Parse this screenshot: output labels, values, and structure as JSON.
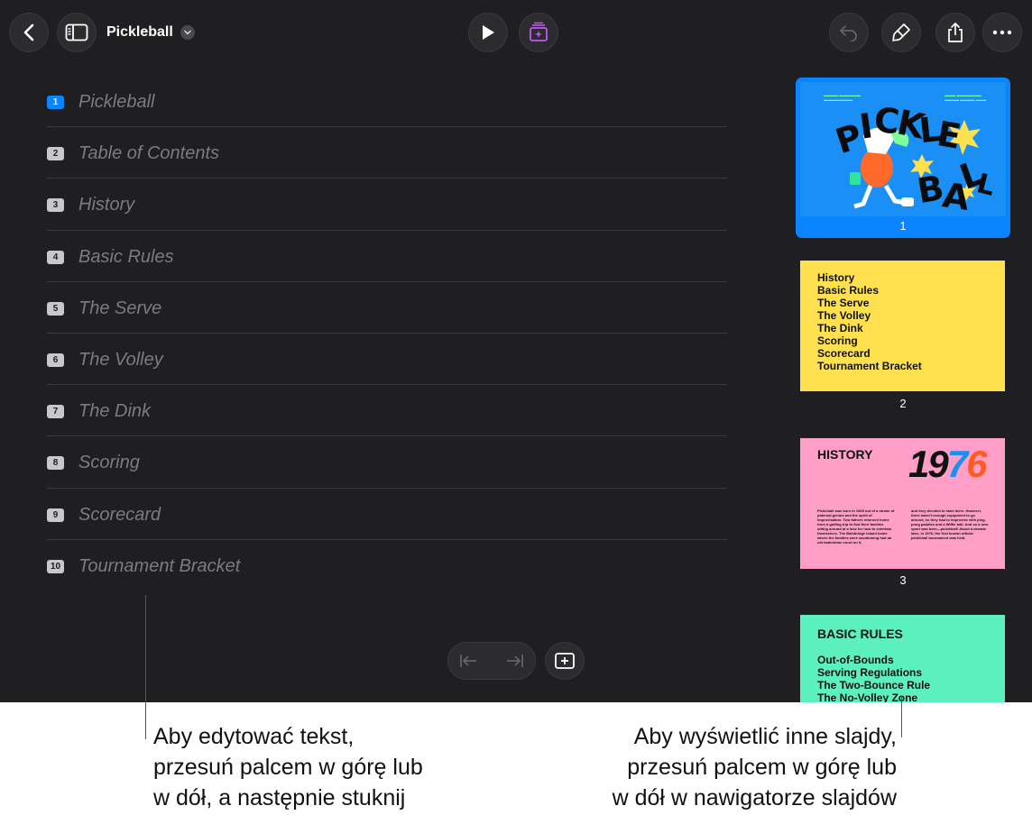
{
  "header": {
    "title": "Pickleball"
  },
  "outline": {
    "items": [
      {
        "num": "1",
        "title": "Pickleball"
      },
      {
        "num": "2",
        "title": "Table of Contents"
      },
      {
        "num": "3",
        "title": "History"
      },
      {
        "num": "4",
        "title": "Basic Rules"
      },
      {
        "num": "5",
        "title": "The Serve"
      },
      {
        "num": "6",
        "title": "The Volley"
      },
      {
        "num": "7",
        "title": "The Dink"
      },
      {
        "num": "8",
        "title": "Scoring"
      },
      {
        "num": "9",
        "title": "Scorecard"
      },
      {
        "num": "10",
        "title": "Tournament Bracket"
      }
    ]
  },
  "navigator": {
    "slide1": {
      "num": "1",
      "letters": "PICKLE BALL"
    },
    "slide2": {
      "num": "2",
      "items": [
        "History",
        "Basic Rules",
        "The Serve",
        "The Volley",
        "The Dink",
        "Scoring",
        "Scorecard",
        "Tournament Bracket"
      ]
    },
    "slide3": {
      "num": "3",
      "heading": "HISTORY",
      "year_a": "19",
      "year_b": "7",
      "year_c": "6",
      "col1": "Pickleball was born in 1965 out of a stroke of paternal genius and the spirit of improvisation. Two fathers returned home from a golfing trip to find their families sitting around at a loss for how to entertain themselves. The Bainbridge Island home where the families were vacationing had an old badminton court on it,",
      "col2": "and they decided to start there. However, there wasn't enough equipment to go around, so they had to improvise with ping-pong paddles and a Wiffle ball. And so a new sport was born—pickleball! About a decade later, in 1976, the first known official pickleball tournament was held."
    },
    "slide4": {
      "heading": "BASIC RULES",
      "items": [
        "Out-of-Bounds",
        "Serving Regulations",
        "The Two-Bounce Rule",
        "The No-Volley Zone"
      ]
    }
  },
  "callouts": {
    "left": [
      "Aby edytować tekst,",
      "przesuń palcem w górę lub",
      "w dół, a następnie stuknij"
    ],
    "right": [
      "Aby wyświetlić inne slajdy,",
      "przesuń palcem w górę lub",
      "w dół w nawigatorze slajdów"
    ]
  },
  "colors": {
    "accent": "#0a84ff",
    "app_background": "#1f1f21",
    "slide2_bg": "#ffe14f",
    "slide3_bg": "#ff9fc7",
    "slide4_bg": "#5cf0bf",
    "ai_icon": "#bf5af2"
  }
}
